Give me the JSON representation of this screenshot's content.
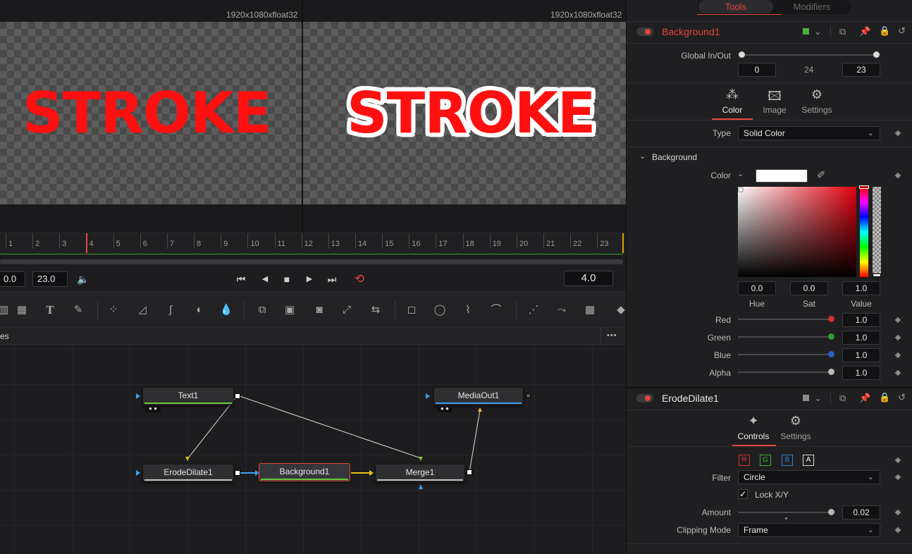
{
  "viewer_left": {
    "resolution": "1920x1080xfloat32",
    "preview_text": "STROKE"
  },
  "viewer_right": {
    "resolution": "1920x1080xfloat32",
    "preview_text": "STROKE"
  },
  "timeline": {
    "ticks": [
      "1",
      "2",
      "3",
      "4",
      "5",
      "6",
      "7",
      "8",
      "9",
      "10",
      "11",
      "12",
      "13",
      "14",
      "15",
      "16",
      "17",
      "18",
      "19",
      "20",
      "21",
      "22",
      "23"
    ],
    "current_frame": "4.0"
  },
  "transport": {
    "start": "0.0",
    "end": "23.0"
  },
  "nodes_panel": {
    "title": "es",
    "more": "•••"
  },
  "nodes": {
    "text1": "Text1",
    "mediaout1": "MediaOut1",
    "erodedilate1": "ErodeDilate1",
    "background1": "Background1",
    "merge1": "Merge1"
  },
  "inspector": {
    "tabs": {
      "tools": "Tools",
      "modifiers": "Modifiers"
    },
    "background_node": {
      "name": "Background1",
      "global_label": "Global In/Out",
      "global_in": "0",
      "global_mid": "24",
      "global_out": "23",
      "subtabs": {
        "color": "Color",
        "image": "Image",
        "settings": "Settings"
      },
      "type_label": "Type",
      "type_value": "Solid Color",
      "section": "Background",
      "color_label": "Color",
      "hue": "0.0",
      "sat": "0.0",
      "value": "1.0",
      "hue_label": "Hue",
      "sat_label": "Sat",
      "value_label": "Value",
      "red_label": "Red",
      "red": "1.0",
      "green_label": "Green",
      "green": "1.0",
      "blue_label": "Blue",
      "blue": "1.0",
      "alpha_label": "Alpha",
      "alpha": "1.0"
    },
    "erode_node": {
      "name": "ErodeDilate1",
      "subtabs": {
        "controls": "Controls",
        "settings": "Settings"
      },
      "channels": [
        "R",
        "G",
        "B",
        "A"
      ],
      "filter_label": "Filter",
      "filter_value": "Circle",
      "lock_label": "Lock X/Y",
      "amount_label": "Amount",
      "amount": "0.02",
      "clip_label": "Clipping Mode",
      "clip_value": "Frame"
    }
  },
  "colors": {
    "accent_red": "#e5453c",
    "green": "#4caf3c",
    "blue": "#2f8ee8",
    "panel": "#1f1f21"
  }
}
